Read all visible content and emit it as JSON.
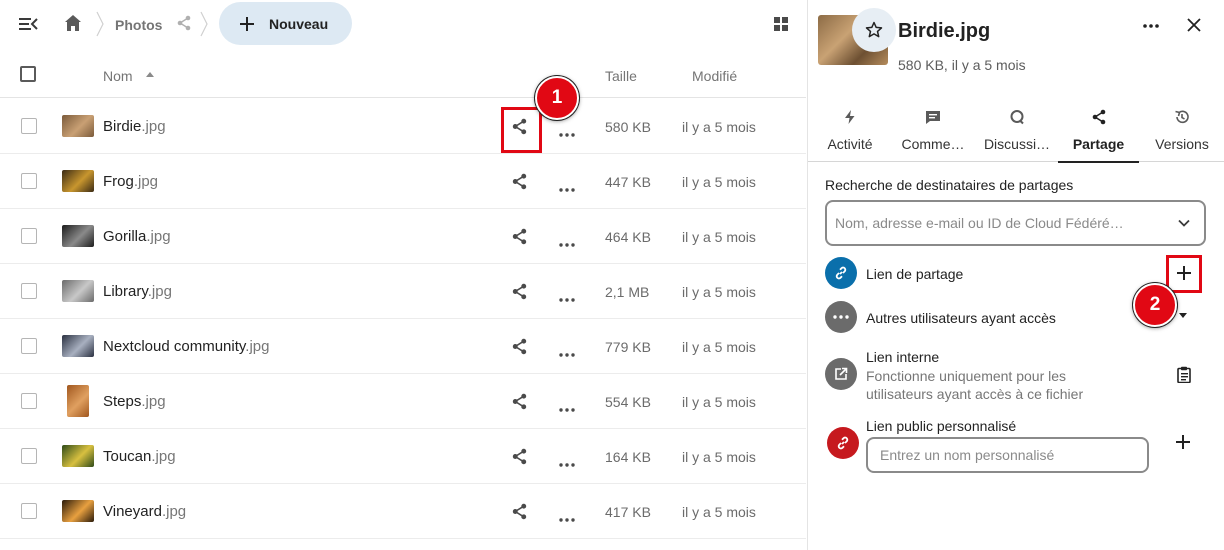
{
  "breadcrumb": {
    "folder": "Photos"
  },
  "new_button": {
    "label": "Nouveau"
  },
  "table": {
    "columns": {
      "name": "Nom",
      "size": "Taille",
      "modified": "Modifié"
    },
    "rows": [
      {
        "name": "Birdie",
        "ext": ".jpg",
        "size": "580 KB",
        "modified": "il y a 5 mois",
        "thumb_colors": [
          "#7a5a3a",
          "#c9a074"
        ]
      },
      {
        "name": "Frog",
        "ext": ".jpg",
        "size": "447 KB",
        "modified": "il y a 5 mois",
        "thumb_colors": [
          "#3a2a14",
          "#c8962e"
        ]
      },
      {
        "name": "Gorilla",
        "ext": ".jpg",
        "size": "464 KB",
        "modified": "il y a 5 mois",
        "thumb_colors": [
          "#1c1c1c",
          "#8a8a8a"
        ]
      },
      {
        "name": "Library",
        "ext": ".jpg",
        "size": "2,1 MB",
        "modified": "il y a 5 mois",
        "thumb_colors": [
          "#6a6a6a",
          "#c8c8c8"
        ]
      },
      {
        "name": "Nextcloud community",
        "ext": ".jpg",
        "size": "779 KB",
        "modified": "il y a 5 mois",
        "thumb_colors": [
          "#2a3040",
          "#a8b0c0"
        ]
      },
      {
        "name": "Steps",
        "ext": ".jpg",
        "size": "554 KB",
        "modified": "il y a 5 mois",
        "thumb_colors": [
          "#a0561e",
          "#e0a060"
        ]
      },
      {
        "name": "Toucan",
        "ext": ".jpg",
        "size": "164 KB",
        "modified": "il y a 5 mois",
        "thumb_colors": [
          "#2e4a18",
          "#d8c040"
        ]
      },
      {
        "name": "Vineyard",
        "ext": ".jpg",
        "size": "417 KB",
        "modified": "il y a 5 mois",
        "thumb_colors": [
          "#2a1a0a",
          "#e8a040"
        ]
      }
    ]
  },
  "annotations": {
    "badge1": "1",
    "badge2": "2",
    "color": "#e10814"
  },
  "sidebar": {
    "title": "Birdie.jpg",
    "subtitle": "580 KB, il y a 5 mois",
    "tabs": [
      {
        "label": "Activité",
        "icon": "lightning-icon"
      },
      {
        "label": "Comme…",
        "icon": "comment-icon"
      },
      {
        "label": "Discussi…",
        "icon": "talk-icon"
      },
      {
        "label": "Partage",
        "icon": "share-icon",
        "active": true
      },
      {
        "label": "Versions",
        "icon": "history-icon"
      }
    ],
    "search": {
      "label": "Recherche de destinataires de partages",
      "placeholder": "Nom, adresse e-mail ou ID de Cloud Fédéré…"
    },
    "share_link": {
      "title": "Lien de partage"
    },
    "others": {
      "title": "Autres utilisateurs ayant accès"
    },
    "internal_link": {
      "title": "Lien interne",
      "subtitle_1": "Fonctionne uniquement pour les",
      "subtitle_2": "utilisateurs ayant accès à ce fichier"
    },
    "custom_link": {
      "title": "Lien public personnalisé",
      "placeholder": "Entrez un nom personnalisé"
    },
    "colors": {
      "link_blue": "#0a6fab",
      "others_gray": "#6b6b6b",
      "internal_gray": "#6b6b6b",
      "custom_red": "#c6191e"
    }
  }
}
